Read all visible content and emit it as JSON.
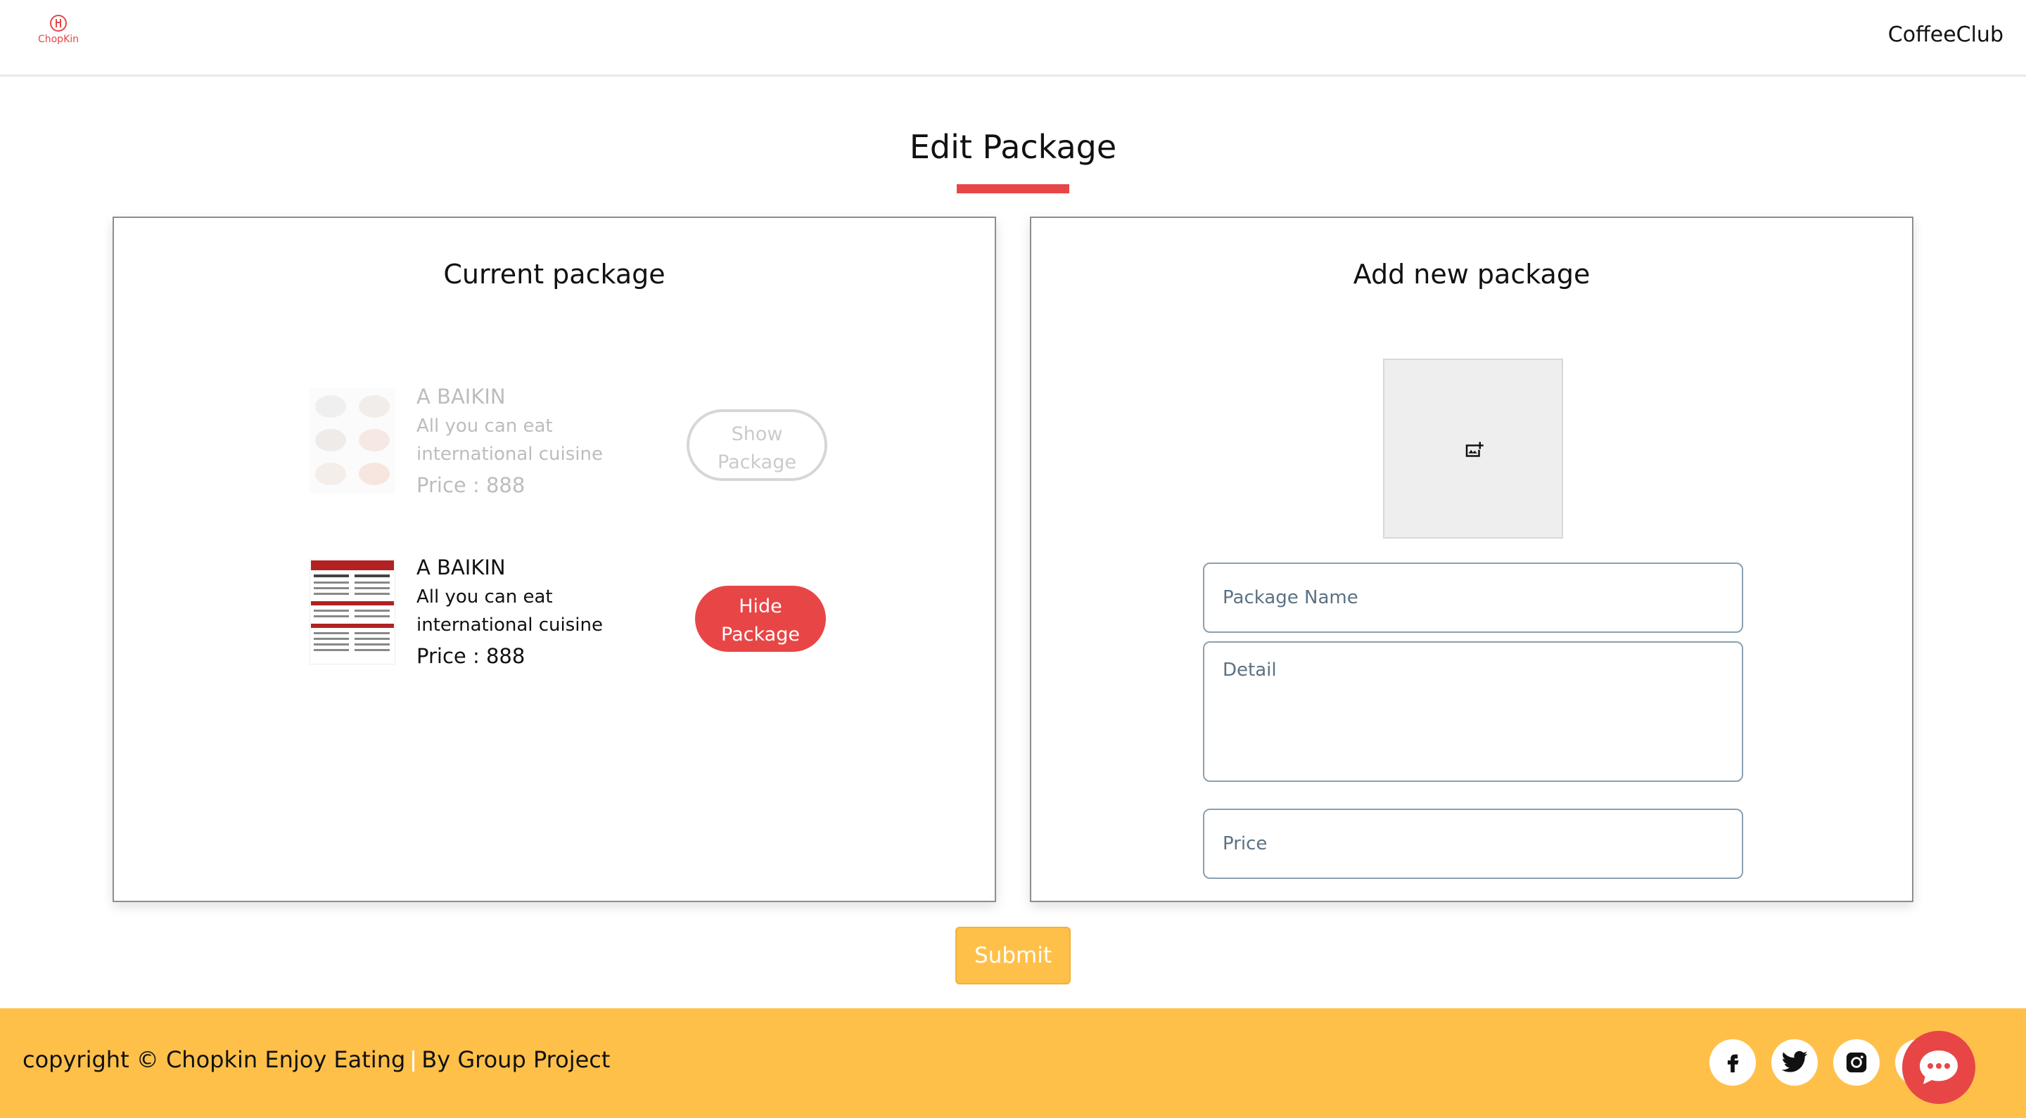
{
  "header": {
    "logo_text": "ChopKin",
    "brand": "CoffeeClub"
  },
  "page": {
    "title": "Edit Package"
  },
  "current_panel": {
    "title": "Current package",
    "packages": [
      {
        "name": "A BAIKIN",
        "detail": "All you can eat international cuisine",
        "price": "Price : 888",
        "button": "Show Package",
        "visible": false
      },
      {
        "name": "A BAIKIN",
        "detail": "All you can eat international cuisine",
        "price": "Price : 888",
        "button": "Hide Package",
        "visible": true
      }
    ]
  },
  "new_panel": {
    "title": "Add new package",
    "upload_icon": "add-photo-icon",
    "name_placeholder": "Package Name",
    "detail_placeholder": "Detail",
    "price_placeholder": "Price"
  },
  "submit_label": "Submit",
  "footer": {
    "copyright": "copyright © Chopkin Enjoy Eating",
    "byline": "By Group Project",
    "social_icons": [
      "facebook-icon",
      "twitter-icon",
      "instagram-icon",
      "linkedin-icon"
    ],
    "chat_icon": "chat-icon"
  },
  "colors": {
    "accent_red": "#e84646",
    "footer_yellow": "#ffc04a",
    "submit_yellow": "#ffc04a"
  }
}
